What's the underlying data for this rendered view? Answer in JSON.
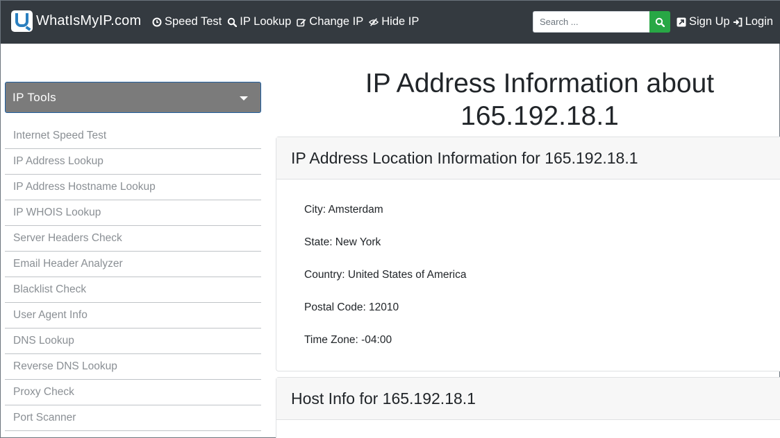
{
  "brand": {
    "name": "WhatIsMyIP.com"
  },
  "nav": {
    "links": [
      {
        "label": "Speed Test",
        "icon": "clock-icon"
      },
      {
        "label": "IP Lookup",
        "icon": "search-icon"
      },
      {
        "label": "Change IP",
        "icon": "edit-icon"
      },
      {
        "label": "Hide IP",
        "icon": "eye-slash-icon"
      }
    ],
    "search_placeholder": "Search ...",
    "signup_label": "Sign Up",
    "login_label": "Login"
  },
  "sidebar": {
    "toggle_label": "IP Tools",
    "items": [
      {
        "label": "Internet Speed Test"
      },
      {
        "label": "IP Address Lookup"
      },
      {
        "label": "IP Address Hostname Lookup"
      },
      {
        "label": "IP WHOIS Lookup"
      },
      {
        "label": "Server Headers Check"
      },
      {
        "label": "Email Header Analyzer"
      },
      {
        "label": "Blacklist Check"
      },
      {
        "label": "User Agent Info"
      },
      {
        "label": "DNS Lookup"
      },
      {
        "label": "Reverse DNS Lookup"
      },
      {
        "label": "Proxy Check"
      },
      {
        "label": "Port Scanner"
      }
    ]
  },
  "main": {
    "title_line1": "IP Address Information about",
    "title_line2": "165.192.18.1",
    "location_card": {
      "header": "IP Address Location Information for 165.192.18.1",
      "lines": [
        "City: Amsterdam",
        "State: New York",
        "Country: United States of America",
        "Postal Code: 12010",
        "Time Zone: -04:00"
      ]
    },
    "host_card": {
      "header": "Host Info for 165.192.18.1"
    }
  },
  "colors": {
    "navbar": "#343a40",
    "search_button": "#28a745",
    "sidebar_toggle": "#7b7b7b",
    "sidebar_link": "#8a8f94"
  }
}
